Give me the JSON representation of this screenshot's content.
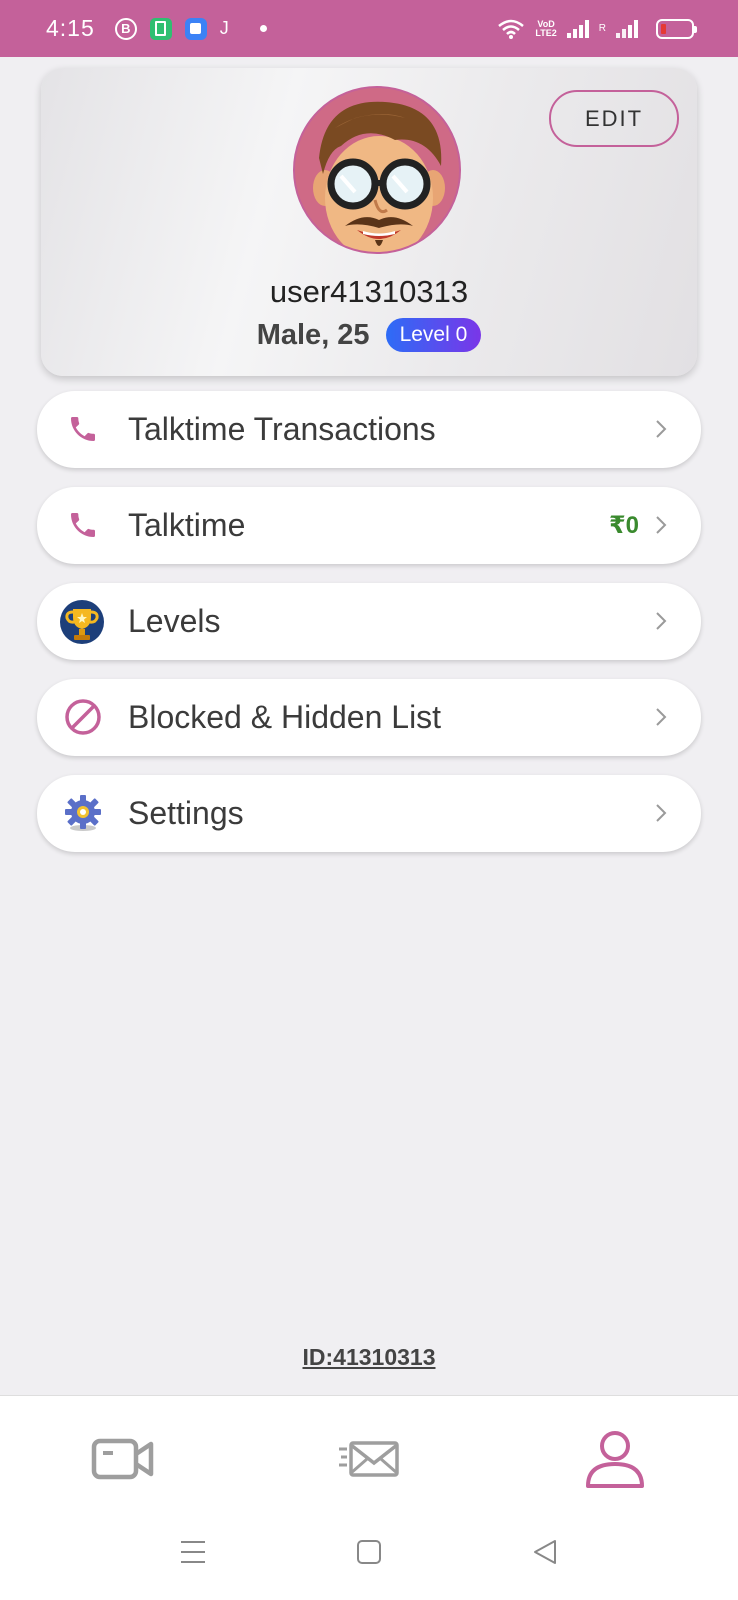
{
  "status_bar": {
    "time": "4:15",
    "b_icon_letter": "B",
    "j_icon_letter": "J",
    "volte_top": "VoD",
    "volte_bottom": "LTE2",
    "roaming_letter": "R",
    "icons": [
      "b-notification-icon",
      "battery-saver-icon",
      "square-app-icon",
      "j-app-icon",
      "dot-icon",
      "wifi-icon",
      "volte-icon",
      "signal-icon",
      "battery-icon"
    ]
  },
  "profile": {
    "edit_label": "EDIT",
    "username": "user41310313",
    "gender_age": "Male, 25",
    "level": "Level 0"
  },
  "menu": [
    {
      "label": "Talktime Transactions",
      "icon": "phone-icon",
      "value": ""
    },
    {
      "label": "Talktime",
      "icon": "phone-icon",
      "value": "₹0"
    },
    {
      "label": "Levels",
      "icon": "trophy-icon",
      "value": ""
    },
    {
      "label": "Blocked & Hidden List",
      "icon": "block-icon",
      "value": ""
    },
    {
      "label": "Settings",
      "icon": "gear-icon",
      "value": ""
    }
  ],
  "user_id": "ID:41310313",
  "bottom_nav": [
    "video-call-icon",
    "messages-icon",
    "profile-icon"
  ],
  "colors": {
    "accent": "#c4619a",
    "value_green": "#3a8a2e",
    "background": "#f0eff2"
  }
}
